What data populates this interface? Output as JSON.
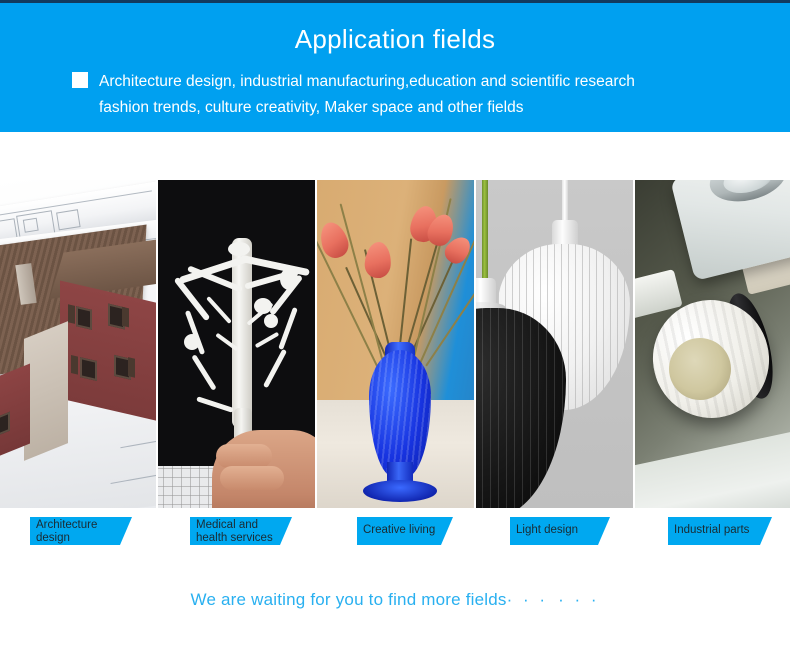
{
  "banner": {
    "title": "Application fields",
    "bullet_icon": "white-square-bullet",
    "line1": "Architecture design, industrial manufacturing,education and scientific research",
    "line2": "fashion trends, culture creativity, Maker space and other fields",
    "bg_color": "#00a0f0",
    "text_color": "#ffffff"
  },
  "gallery": {
    "items": [
      {
        "id": "architecture",
        "label_line1": "Architecture",
        "label_line2": "design",
        "alt": "3D printed house model resting on rolled architectural blueprints"
      },
      {
        "id": "medical",
        "label_line1": "Medical and",
        "label_line2": "health services",
        "alt": "Hand holding a white 3D printed vascular / organ anatomy model on black background"
      },
      {
        "id": "creative-living",
        "label_line1": "Creative living",
        "label_line2": "",
        "alt": "Blue 3D printed spiral vase holding pink tulips on a table"
      },
      {
        "id": "light-design",
        "label_line1": "Light design",
        "label_line2": "",
        "alt": "Black and white ribbed 3D printed pendant lamp shades"
      },
      {
        "id": "industrial-parts",
        "label_line1": "Industrial parts",
        "label_line2": "",
        "alt": "White 3D printed plastic industrial pipe fitting with black o-ring"
      }
    ],
    "label_bg_color": "#00a8f0",
    "label_text_color": "#1a2b33"
  },
  "footer": {
    "tagline": "We are waiting for you to find more fields",
    "dots": "· · ·",
    "dots2": "· · ·",
    "color": "#29b0f0"
  }
}
